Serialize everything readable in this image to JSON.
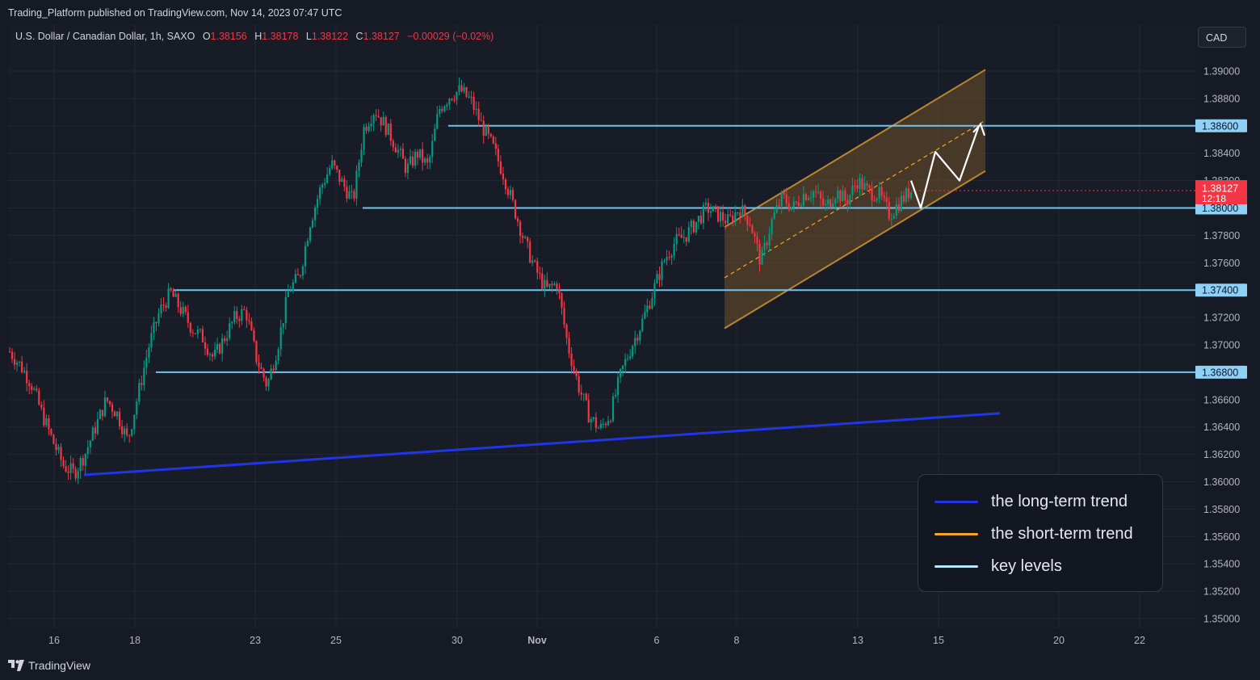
{
  "publisher": "Trading_Platform published on TradingView.com, Nov 14, 2023 07:47 UTC",
  "symbol": {
    "name": "U.S. Dollar / Canadian Dollar, 1h, SAXO",
    "o_label": "O",
    "o": "1.38156",
    "h_label": "H",
    "h": "1.38178",
    "l_label": "L",
    "l": "1.38122",
    "c_label": "C",
    "c": "1.38127",
    "change": "−0.00029 (−0.02%)"
  },
  "currency": "CAD",
  "current_price": {
    "value": "1.38127",
    "countdown": "12:18"
  },
  "footer_logo": "TradingView",
  "colors": {
    "up": "#089981",
    "down": "#f23645",
    "long_trend": "#2036e6",
    "short_trend": "#f5a623",
    "key_level": "#6ec4f2",
    "channel_fill": "#8a5f2a"
  },
  "legend": [
    {
      "label": "the long-term trend",
      "color": "#2036e6"
    },
    {
      "label": "the short-term trend",
      "color": "#f5a623"
    },
    {
      "label": "key levels",
      "color": "#b8e8ff"
    }
  ],
  "chart_data": {
    "type": "candlestick",
    "y_axis": {
      "range": [
        1.3493,
        1.3912
      ],
      "ticks": [
        "1.39000",
        "1.38800",
        "1.38600",
        "1.38400",
        "1.38200",
        "1.38000",
        "1.37800",
        "1.37600",
        "1.37400",
        "1.37200",
        "1.37000",
        "1.36800",
        "1.36600",
        "1.36400",
        "1.36200",
        "1.36000",
        "1.35800",
        "1.35600",
        "1.35400",
        "1.35200",
        "1.35000"
      ]
    },
    "x_axis": {
      "ticks": [
        {
          "label": "16",
          "bold": false
        },
        {
          "label": "18",
          "bold": false
        },
        {
          "label": "23",
          "bold": false
        },
        {
          "label": "25",
          "bold": false
        },
        {
          "label": "30",
          "bold": false
        },
        {
          "label": "Nov",
          "bold": true
        },
        {
          "label": "6",
          "bold": false
        },
        {
          "label": "8",
          "bold": false
        },
        {
          "label": "13",
          "bold": false
        },
        {
          "label": "15",
          "bold": false
        },
        {
          "label": "20",
          "bold": false
        },
        {
          "label": "22",
          "bold": false
        }
      ]
    },
    "key_levels": [
      {
        "label": "1.38600",
        "value": 1.386
      },
      {
        "label": "1.38000",
        "value": 1.38
      },
      {
        "label": "1.37400",
        "value": 1.374
      },
      {
        "label": "1.36800",
        "value": 1.368
      }
    ],
    "price_path": [
      [
        0,
        1.3695
      ],
      [
        1,
        1.3685
      ],
      [
        2,
        1.3672
      ],
      [
        3,
        1.365
      ],
      [
        4,
        1.363
      ],
      [
        5,
        1.3612
      ],
      [
        6,
        1.3606
      ],
      [
        7,
        1.362
      ],
      [
        8,
        1.364
      ],
      [
        9,
        1.366
      ],
      [
        10,
        1.365
      ],
      [
        11,
        1.363
      ],
      [
        12,
        1.3665
      ],
      [
        13,
        1.37
      ],
      [
        14,
        1.3725
      ],
      [
        15,
        1.3738
      ],
      [
        16,
        1.3725
      ],
      [
        17,
        1.3712
      ],
      [
        18,
        1.3705
      ],
      [
        19,
        1.369
      ],
      [
        20,
        1.3705
      ],
      [
        21,
        1.372
      ],
      [
        22,
        1.3725
      ],
      [
        23,
        1.369
      ],
      [
        24,
        1.367
      ],
      [
        25,
        1.37
      ],
      [
        26,
        1.374
      ],
      [
        27,
        1.375
      ],
      [
        28,
        1.379
      ],
      [
        29,
        1.3815
      ],
      [
        30,
        1.3832
      ],
      [
        31,
        1.3818
      ],
      [
        32,
        1.3805
      ],
      [
        33,
        1.3858
      ],
      [
        34,
        1.3872
      ],
      [
        35,
        1.386
      ],
      [
        36,
        1.3845
      ],
      [
        37,
        1.3828
      ],
      [
        38,
        1.384
      ],
      [
        39,
        1.383
      ],
      [
        40,
        1.3872
      ],
      [
        41,
        1.3882
      ],
      [
        42,
        1.3886
      ],
      [
        43,
        1.3878
      ],
      [
        44,
        1.386
      ],
      [
        45,
        1.3845
      ],
      [
        46,
        1.3825
      ],
      [
        47,
        1.38
      ],
      [
        48,
        1.3775
      ],
      [
        49,
        1.3755
      ],
      [
        50,
        1.374
      ],
      [
        51,
        1.3745
      ],
      [
        52,
        1.37
      ],
      [
        53,
        1.367
      ],
      [
        54,
        1.3648
      ],
      [
        55,
        1.3638
      ],
      [
        56,
        1.365
      ],
      [
        57,
        1.368
      ],
      [
        58,
        1.37
      ],
      [
        59,
        1.3718
      ],
      [
        60,
        1.374
      ],
      [
        61,
        1.3762
      ],
      [
        62,
        1.3775
      ],
      [
        63,
        1.378
      ],
      [
        64,
        1.379
      ],
      [
        65,
        1.38
      ],
      [
        66,
        1.3795
      ],
      [
        67,
        1.379
      ],
      [
        68,
        1.38
      ],
      [
        69,
        1.379
      ],
      [
        70,
        1.376
      ],
      [
        71,
        1.379
      ],
      [
        72,
        1.3808
      ],
      [
        73,
        1.38
      ],
      [
        74,
        1.381
      ],
      [
        75,
        1.3812
      ],
      [
        76,
        1.38
      ],
      [
        77,
        1.3812
      ],
      [
        78,
        1.3805
      ],
      [
        79,
        1.382
      ],
      [
        80,
        1.3812
      ],
      [
        81,
        1.381
      ],
      [
        82,
        1.3795
      ],
      [
        83,
        1.3805
      ],
      [
        84,
        1.3813
      ]
    ],
    "annotations": {
      "long_term_trendline": {
        "from": [
          "Oct 17",
          1.3605
        ],
        "to": [
          "Nov 17",
          1.365
        ]
      },
      "channel_upper": {
        "from": [
          "Nov 7",
          1.3786
        ],
        "to": [
          "Nov 17",
          1.3901
        ]
      },
      "channel_lower": {
        "from": [
          "Nov 7",
          1.3712
        ],
        "to": [
          "Nov 17",
          1.3827
        ]
      },
      "projection_zigzag": [
        1.382,
        1.38,
        1.3841,
        1.382,
        1.386
      ]
    }
  }
}
